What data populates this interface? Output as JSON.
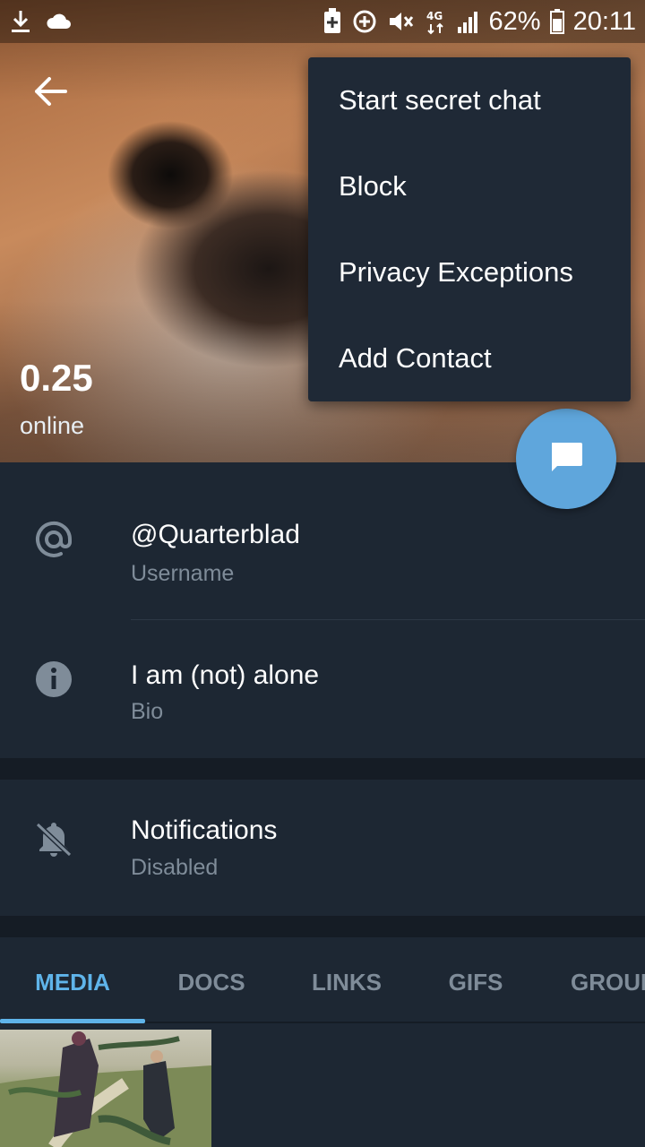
{
  "status_bar": {
    "battery_percent": "62%",
    "time": "20:11",
    "network_label": "4G"
  },
  "profile": {
    "name": "0.25",
    "status": "online"
  },
  "menu": {
    "items": [
      {
        "label": "Start secret chat"
      },
      {
        "label": "Block"
      },
      {
        "label": "Privacy Exceptions"
      },
      {
        "label": "Add Contact"
      }
    ]
  },
  "info": {
    "username": {
      "value": "@Quarterblad",
      "caption": "Username",
      "icon": "at-icon"
    },
    "bio": {
      "value": "I am (not) alone",
      "caption": "Bio",
      "icon": "info-icon"
    },
    "notifications": {
      "value": "Notifications",
      "caption": "Disabled",
      "icon": "bell-off-icon"
    }
  },
  "tabs": [
    {
      "label": "MEDIA",
      "active": true
    },
    {
      "label": "DOCS",
      "active": false
    },
    {
      "label": "LINKS",
      "active": false
    },
    {
      "label": "GIFS",
      "active": false
    },
    {
      "label": "GROUPS",
      "active": false
    }
  ],
  "colors": {
    "background": "#1d2733",
    "accent": "#5fb4ea",
    "fab": "#5fa6dc",
    "secondary_text": "#7f8c99"
  }
}
